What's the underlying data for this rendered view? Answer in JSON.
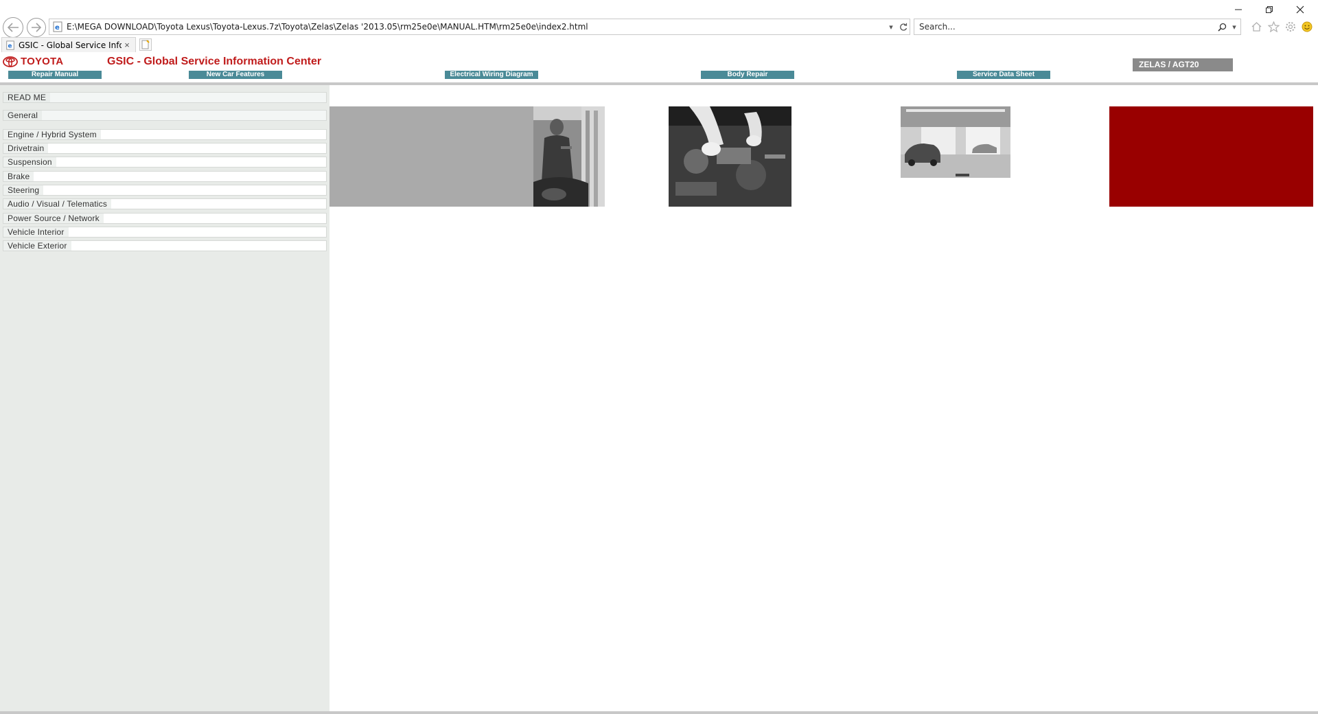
{
  "browser": {
    "address": "E:\\MEGA DOWNLOAD\\Toyota Lexus\\Toyota-Lexus.7z\\Toyota\\Zelas\\Zelas '2013.05\\rm25e0e\\MANUAL.HTM\\rm25e0e\\index2.html",
    "search_placeholder": "Search...",
    "tab_title": "GSIC - Global Service Infor...",
    "tab_close": "×"
  },
  "header": {
    "brand": "TOYOTA",
    "title": "GSIC - Global Service Information Center",
    "model": "ZELAS / AGT20",
    "nav": [
      {
        "label": "Repair Manual"
      },
      {
        "label": "New Car Features"
      },
      {
        "label": "Electrical Wiring Diagram"
      },
      {
        "label": "Body Repair"
      },
      {
        "label": "Service Data Sheet"
      }
    ]
  },
  "sidebar": {
    "items": [
      {
        "label": "READ ME"
      },
      {
        "label": "General"
      },
      {
        "label": "Engine / Hybrid System"
      },
      {
        "label": "Drivetrain"
      },
      {
        "label": "Suspension"
      },
      {
        "label": "Brake"
      },
      {
        "label": "Steering"
      },
      {
        "label": "Audio / Visual / Telematics"
      },
      {
        "label": "Power Source / Network"
      },
      {
        "label": "Vehicle Interior"
      },
      {
        "label": "Vehicle Exterior"
      }
    ]
  },
  "colors": {
    "brand_red": "#c01c1c",
    "nav_teal": "#4a8a97",
    "banner_red": "#990000",
    "banner_gray": "#aaaaaa",
    "sidebar_bg": "#e8ebe8"
  },
  "icons": [
    "back-arrow-icon",
    "forward-arrow-icon",
    "ie-page-icon",
    "dropdown-icon",
    "refresh-icon",
    "search-icon",
    "home-icon",
    "favorites-star-icon",
    "settings-gear-icon",
    "smiley-feedback-icon",
    "minimize-icon",
    "restore-icon",
    "close-icon",
    "toyota-logo-icon",
    "new-tab-icon"
  ]
}
